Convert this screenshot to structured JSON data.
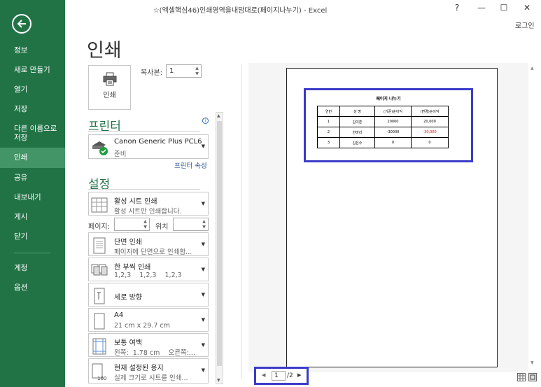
{
  "window": {
    "title": "☆(엑셀핵심46)인쇄영역을내맘대로(페이지나누기) - Excel",
    "help": "?",
    "minimize": "—",
    "maximize": "☐",
    "close": "✕",
    "login": "로그인"
  },
  "sidebar": {
    "items": [
      {
        "label": "정보"
      },
      {
        "label": "새로 만들기"
      },
      {
        "label": "열기"
      },
      {
        "label": "저장"
      },
      {
        "label": "다른 이름으로\n저장"
      },
      {
        "label": "인쇄"
      },
      {
        "label": "공유"
      },
      {
        "label": "내보내기"
      },
      {
        "label": "게시"
      },
      {
        "label": "닫기"
      },
      {
        "label": "계정"
      },
      {
        "label": "옵션"
      }
    ],
    "selected": "인쇄"
  },
  "print": {
    "heading": "인쇄",
    "print_button": "인쇄",
    "copies_label": "복사본:",
    "copies_value": "1"
  },
  "printer": {
    "section_title": "프린터",
    "name": "Canon Generic Plus PCL6",
    "status": "준비",
    "properties_link": "프린터 속성"
  },
  "settings": {
    "section_title": "설정",
    "options": [
      {
        "main": "활성 시트 인쇄",
        "sub": "활성 시트만 인쇄합니다."
      },
      {
        "main": "단면 인쇄",
        "sub": "페이지에 단면으로 인쇄합..."
      },
      {
        "main": "한 부씩 인쇄",
        "sub": "1,2,3    1,2,3    1,2,3"
      },
      {
        "main": "세로 방향",
        "sub": ""
      },
      {
        "main": "A4",
        "sub": "21 cm x 29.7 cm"
      },
      {
        "main": "보통 여백",
        "sub": "왼쪽:  1.78 cm    오른쪽:..."
      },
      {
        "main": "현재 설정된 용지",
        "sub": "실제 크기로 시트를 인쇄..."
      }
    ],
    "pages_label": "페이지:",
    "to_label": "위치"
  },
  "preview": {
    "sheet_title": "페이지 나누기",
    "columns": [
      "연번",
      "성  명",
      "(기준)순이익",
      "(변경)순이익"
    ],
    "rows": [
      [
        "1",
        "김이훈",
        "20000",
        "20,000"
      ],
      [
        "2",
        "한마라",
        "-30000",
        "-30,000"
      ],
      [
        "3",
        "김은수",
        "0",
        "0"
      ]
    ],
    "negative_color": "#e00000"
  },
  "pager": {
    "current": "1",
    "total": "/2"
  },
  "colors": {
    "sidebar": "#217346",
    "sidebar_selected": "#439467",
    "highlight": "#3b3bc8"
  }
}
